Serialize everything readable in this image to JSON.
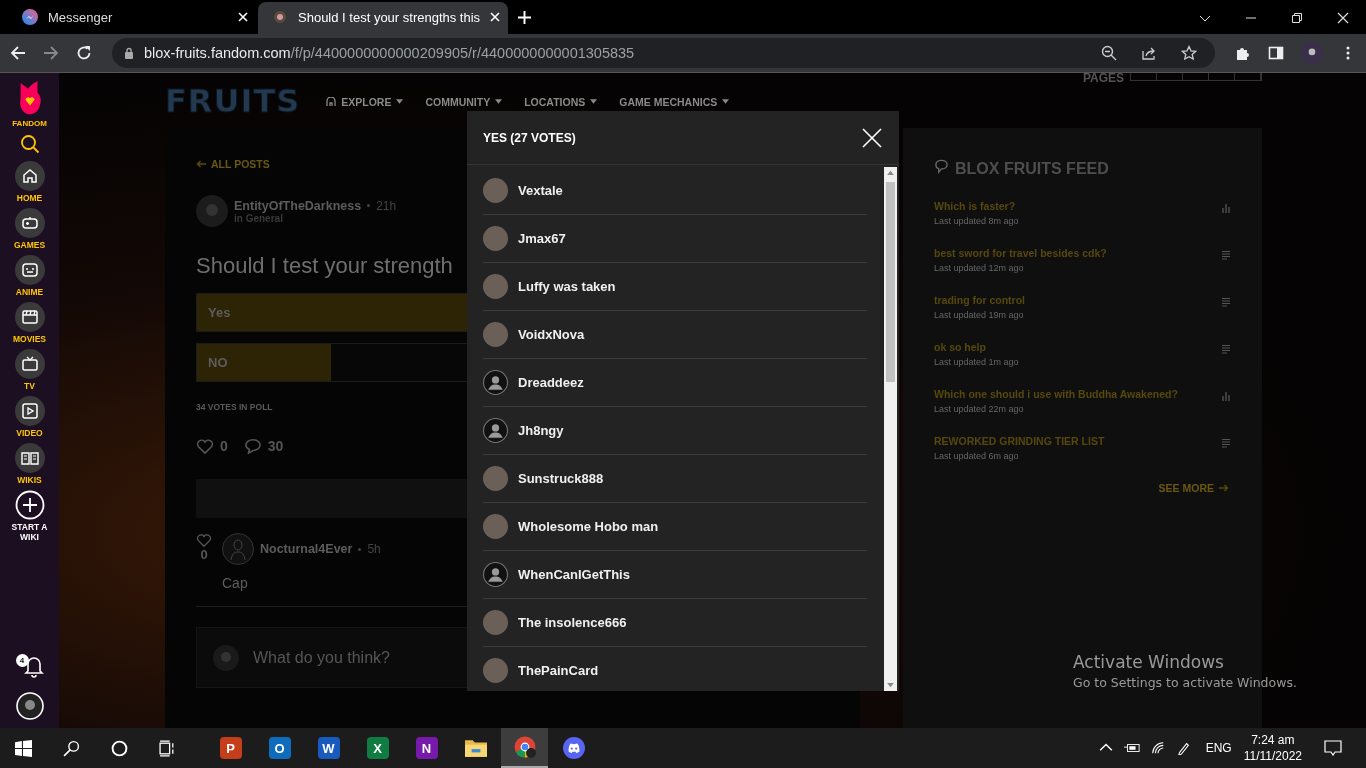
{
  "browser": {
    "tabs": [
      {
        "title": "Messenger",
        "kind": "messenger",
        "selected": false
      },
      {
        "title": "Should I test your strengths this",
        "kind": "page",
        "selected": true
      }
    ],
    "url_host": "blox-fruits.fandom.com",
    "url_path": "/f/p/4400000000000209905/r/4400000000001305835"
  },
  "fandom_rail": {
    "logo": "FANDOM",
    "items": [
      {
        "label": "HOME",
        "kind": "home"
      },
      {
        "label": "GAMES",
        "kind": "games"
      },
      {
        "label": "ANIME",
        "kind": "anime"
      },
      {
        "label": "MOVIES",
        "kind": "movies"
      },
      {
        "label": "TV",
        "kind": "tv"
      },
      {
        "label": "VIDEO",
        "kind": "video"
      },
      {
        "label": "WIKIS",
        "kind": "wikis"
      }
    ],
    "start_wiki": "START A WIKI",
    "notification_count": "4"
  },
  "wiki_header": {
    "logo": "FRUITS",
    "nav": [
      "EXPLORE",
      "COMMUNITY",
      "LOCATIONS",
      "GAME MECHANICS"
    ],
    "pages": "PAGES"
  },
  "post": {
    "back": "ALL POSTS",
    "author": "EntityOfTheDarkness",
    "time": "21h",
    "category": "in General",
    "title": "Should I test your strength",
    "options": [
      {
        "label": "Yes",
        "level": 0.79
      },
      {
        "label": "NO",
        "level": 0.21
      }
    ],
    "votes": "34 VOTES IN POLL",
    "likes": "0",
    "comments": "30",
    "replies": [
      {
        "likes": "0",
        "author": "Nocturnal4Ever",
        "time": "5h",
        "text": "Cap"
      }
    ],
    "reply_placeholder": "What do you think?"
  },
  "feed": {
    "title": "BLOX FRUITS FEED",
    "items": [
      {
        "title": "Which is faster?",
        "updated": "Last updated 8m ago",
        "kind": "poll"
      },
      {
        "title": "best sword for travel besides cdk?",
        "updated": "Last updated 12m ago",
        "kind": "text"
      },
      {
        "title": "trading for control",
        "updated": "Last updated 19m ago",
        "kind": "text"
      },
      {
        "title": "ok so help",
        "updated": "Last updated 1m ago",
        "kind": "text"
      },
      {
        "title": "Which one should i use with Buddha Awakened?",
        "updated": "Last updated 22m ago",
        "kind": "poll"
      },
      {
        "title": "REWORKED GRINDING TIER LIST",
        "updated": "Last updated 6m ago",
        "kind": "text"
      }
    ],
    "see_more": "SEE MORE"
  },
  "modal": {
    "title": "YES (27 VOTES)",
    "voters": [
      {
        "name": "Vextale",
        "kind": "picture"
      },
      {
        "name": "Jmax67",
        "kind": "picture"
      },
      {
        "name": "Luffy was taken",
        "kind": "picture"
      },
      {
        "name": "VoidxNova",
        "kind": "picture"
      },
      {
        "name": "Dreaddeez",
        "kind": "default"
      },
      {
        "name": "Jh8ngy",
        "kind": "default"
      },
      {
        "name": "Sunstruck888",
        "kind": "picture"
      },
      {
        "name": "Wholesome Hobo man",
        "kind": "picture"
      },
      {
        "name": "WhenCanIGetThis",
        "kind": "default"
      },
      {
        "name": "The insolence666",
        "kind": "picture"
      },
      {
        "name": "ThePainCard",
        "kind": "picture"
      }
    ]
  },
  "activation": {
    "title": "Activate Windows",
    "subtitle": "Go to Settings to activate Windows."
  },
  "taskbar": {
    "apps": [
      {
        "kind": "powerpoint",
        "glyph": "P",
        "selected": false
      },
      {
        "kind": "outlook",
        "glyph": "O",
        "selected": false
      },
      {
        "kind": "word",
        "glyph": "W",
        "selected": false
      },
      {
        "kind": "excel",
        "glyph": "X",
        "selected": false
      },
      {
        "kind": "onenote",
        "glyph": "N",
        "selected": false
      },
      {
        "kind": "folder",
        "selected": false
      },
      {
        "kind": "chrome",
        "selected": true
      },
      {
        "kind": "discord",
        "selected": false
      }
    ],
    "language": "ENG",
    "time": "7:24 am",
    "date": "11/11/2022"
  }
}
